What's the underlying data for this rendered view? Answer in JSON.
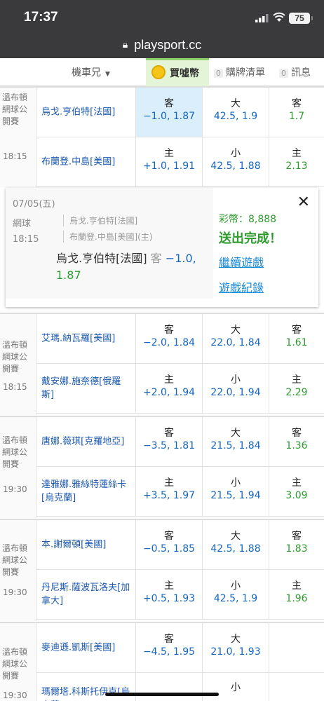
{
  "status": {
    "time": "17:37",
    "battery": "75"
  },
  "browser": {
    "url": "playsport.cc"
  },
  "nav": {
    "user": "機車兄",
    "buy_coins": "買噓幣",
    "cart_count": "0",
    "cart_label": "購牌清單",
    "msg_count": "0",
    "msg_label": "訊息"
  },
  "colors": {
    "accent_green": "#2e9b2e",
    "line_blue": "#1565c0",
    "team_blue": "#1a57b0",
    "selected_bg": "#dbeefb",
    "buy_bg": "#e4f5d7"
  },
  "matches": [
    {
      "league": "溫布頓網球公開賽",
      "time": "18:15",
      "away": {
        "team": "烏戈.亨伯特[法國]",
        "spread_label": "客",
        "spread": "−1.0, 1.87",
        "total_label": "大",
        "total": "42.5, 1.9",
        "ml_label": "客",
        "ml": "1.7"
      },
      "home": {
        "team": "布蘭登.中島[美國]",
        "spread_label": "主",
        "spread": "+1.0, 1.91",
        "total_label": "小",
        "total": "42.5, 1.88",
        "ml_label": "主",
        "ml": "2.13"
      }
    },
    {
      "league": "溫布頓網球公開賽",
      "time": "18:15",
      "away": {
        "team": "艾瑪.納瓦羅[美國]",
        "spread_label": "客",
        "spread": "−2.0, 1.84",
        "total_label": "大",
        "total": "22.0, 1.84",
        "ml_label": "客",
        "ml": "1.61"
      },
      "home": {
        "team": "戴安娜.施奈德[俄羅斯]",
        "spread_label": "主",
        "spread": "+2.0, 1.94",
        "total_label": "小",
        "total": "22.0, 1.94",
        "ml_label": "主",
        "ml": "2.29"
      }
    },
    {
      "league": "溫布頓網球公開賽",
      "time": "19:30",
      "away": {
        "team": "唐娜.薇琪[克羅地亞]",
        "spread_label": "客",
        "spread": "−3.5, 1.81",
        "total_label": "大",
        "total": "21.5, 1.84",
        "ml_label": "客",
        "ml": "1.36"
      },
      "home": {
        "team": "達雅娜.雅絲特蓮絲卡[烏克蘭]",
        "spread_label": "主",
        "spread": "+3.5, 1.97",
        "total_label": "小",
        "total": "21.5, 1.94",
        "ml_label": "主",
        "ml": "3.09"
      }
    },
    {
      "league": "溫布頓網球公開賽",
      "time": "19:30",
      "away": {
        "team": "本.謝爾頓[美國]",
        "spread_label": "客",
        "spread": "−0.5, 1.85",
        "total_label": "大",
        "total": "42.5, 1.88",
        "ml_label": "客",
        "ml": "1.83"
      },
      "home": {
        "team": "丹尼斯.薩波瓦洛夫[加拿大]",
        "spread_label": "主",
        "spread": "+0.5, 1.93",
        "total_label": "小",
        "total": "42.5, 1.9",
        "ml_label": "主",
        "ml": "1.96"
      }
    },
    {
      "league": "溫布頓網球公開賽",
      "time": "19:30",
      "away": {
        "team": "麥迪遜.凱斯[美國]",
        "spread_label": "客",
        "spread": "−4.5, 1.95",
        "total_label": "大",
        "total": "21.0, 1.93",
        "ml_label": "",
        "ml": ""
      },
      "home": {
        "team": "瑪爾塔.科斯托伊克[烏克蘭]",
        "spread_label": "",
        "spread": "",
        "total_label": "小",
        "total": "",
        "ml_label": "",
        "ml": ""
      }
    }
  ],
  "popup": {
    "date": "07/05(五)",
    "sport": "網球",
    "time": "18:15",
    "team1": "烏戈.亨伯特[法國]",
    "team2": "布蘭登.中島[美國](主)",
    "pick_team": "烏戈.亨伯特[法國]",
    "pick_side": "客",
    "pick_line": "−1.0,",
    "pick_odds": "1.87",
    "coins": "彩幣：8,888",
    "done": "送出完成！",
    "link_continue": "繼續遊戲",
    "link_history": "遊戲紀錄",
    "close": "✕"
  }
}
